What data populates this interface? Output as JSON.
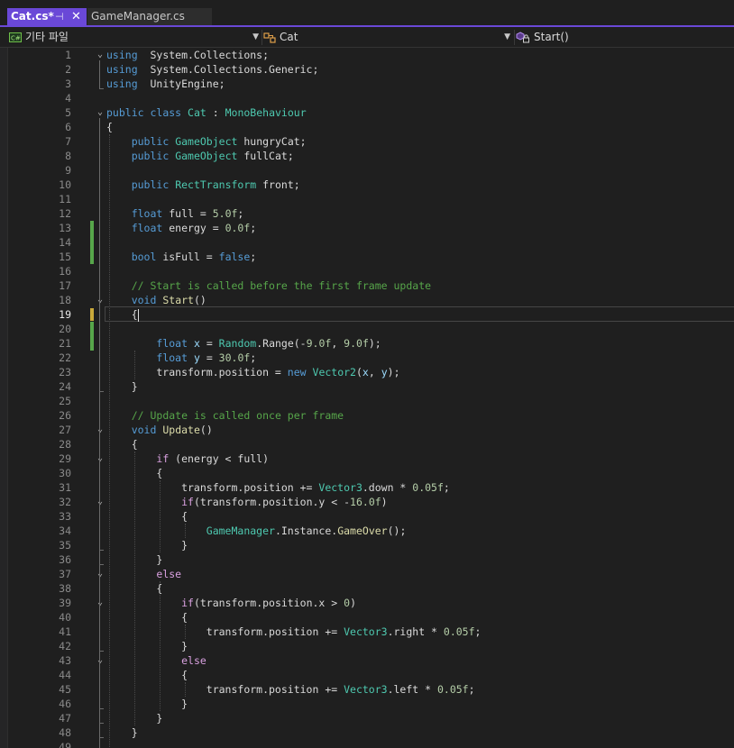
{
  "tabs": [
    {
      "label": "Cat.cs*",
      "active": true
    },
    {
      "label": "GameManager.cs",
      "active": false
    }
  ],
  "icons": {
    "tab_pin": "pin-icon",
    "tab_close": "close-icon",
    "project": "csharp-project-icon",
    "class": "class-icon",
    "member": "method-lock-icon",
    "dropdown": "chevron-down-icon"
  },
  "navbar": {
    "project": "기타 파일",
    "class": "Cat",
    "member": "Start()"
  },
  "colors": {
    "accent": "#6a48d7",
    "keyword": "#569cd6",
    "type": "#4ec9b0",
    "comment": "#57a64a",
    "number": "#b5cea8",
    "variable": "#9cdcfe",
    "control": "#d8a0df",
    "method": "#dcdcaa",
    "saved_change": "#57a64a",
    "unsaved_change": "#c9a93a"
  },
  "editor": {
    "current_line": 19,
    "lines": [
      [
        [
          "kw",
          "using"
        ],
        [
          "",
          "  System.Collections;"
        ]
      ],
      [
        [
          "kw",
          "using"
        ],
        [
          "",
          "  System.Collections.Generic;"
        ]
      ],
      [
        [
          "kw",
          "using"
        ],
        [
          "",
          "  UnityEngine;"
        ]
      ],
      [],
      [
        [
          "kw",
          "public"
        ],
        [
          "",
          " "
        ],
        [
          "kw",
          "class"
        ],
        [
          "",
          " "
        ],
        [
          "ty",
          "Cat"
        ],
        [
          "",
          " : "
        ],
        [
          "ty",
          "MonoBehaviour"
        ]
      ],
      [
        [
          "",
          "{"
        ]
      ],
      [
        [
          "",
          "    "
        ],
        [
          "kw",
          "public"
        ],
        [
          "",
          " "
        ],
        [
          "ty",
          "GameObject"
        ],
        [
          "",
          " hungryCat;"
        ]
      ],
      [
        [
          "",
          "    "
        ],
        [
          "kw",
          "public"
        ],
        [
          "",
          " "
        ],
        [
          "ty",
          "GameObject"
        ],
        [
          "",
          " fullCat;"
        ]
      ],
      [],
      [
        [
          "",
          "    "
        ],
        [
          "kw",
          "public"
        ],
        [
          "",
          " "
        ],
        [
          "ty",
          "RectTransform"
        ],
        [
          "",
          " front;"
        ]
      ],
      [],
      [
        [
          "",
          "    "
        ],
        [
          "kw",
          "float"
        ],
        [
          "",
          " full = "
        ],
        [
          "nm",
          "5.0f"
        ],
        [
          "",
          ";"
        ]
      ],
      [
        [
          "",
          "    "
        ],
        [
          "kw",
          "float"
        ],
        [
          "",
          " energy = "
        ],
        [
          "nm",
          "0.0f"
        ],
        [
          "",
          ";"
        ]
      ],
      [],
      [
        [
          "",
          "    "
        ],
        [
          "kw",
          "bool"
        ],
        [
          "",
          " isFull = "
        ],
        [
          "kw",
          "false"
        ],
        [
          "",
          ";"
        ]
      ],
      [],
      [
        [
          "",
          "    "
        ],
        [
          "cm",
          "// Start is called before the first frame update"
        ]
      ],
      [
        [
          "",
          "    "
        ],
        [
          "kw",
          "void"
        ],
        [
          "",
          " "
        ],
        [
          "fn",
          "Start"
        ],
        [
          "",
          "()"
        ]
      ],
      [
        [
          "",
          "    {"
        ],
        [
          "cursor",
          ""
        ]
      ],
      [],
      [
        [
          "",
          "        "
        ],
        [
          "kw",
          "float"
        ],
        [
          "",
          " "
        ],
        [
          "vr",
          "x"
        ],
        [
          "",
          " = "
        ],
        [
          "ty",
          "Random"
        ],
        [
          "",
          ".Range(-"
        ],
        [
          "nm",
          "9.0f"
        ],
        [
          "",
          ", "
        ],
        [
          "nm",
          "9.0f"
        ],
        [
          "",
          ");"
        ]
      ],
      [
        [
          "",
          "        "
        ],
        [
          "kw",
          "float"
        ],
        [
          "",
          " "
        ],
        [
          "vr",
          "y"
        ],
        [
          "",
          " = "
        ],
        [
          "nm",
          "30.0f"
        ],
        [
          "",
          ";"
        ]
      ],
      [
        [
          "",
          "        transform.position = "
        ],
        [
          "kw",
          "new"
        ],
        [
          "",
          " "
        ],
        [
          "ty",
          "Vector2"
        ],
        [
          "",
          "("
        ],
        [
          "vr",
          "x"
        ],
        [
          "",
          ", "
        ],
        [
          "vr",
          "y"
        ],
        [
          "",
          ");"
        ]
      ],
      [
        [
          "",
          "    }"
        ]
      ],
      [],
      [
        [
          "",
          "    "
        ],
        [
          "cm",
          "// Update is called once per frame"
        ]
      ],
      [
        [
          "",
          "    "
        ],
        [
          "kw",
          "void"
        ],
        [
          "",
          " "
        ],
        [
          "fn",
          "Update"
        ],
        [
          "",
          "()"
        ]
      ],
      [
        [
          "",
          "    {"
        ]
      ],
      [
        [
          "",
          "        "
        ],
        [
          "kc",
          "if"
        ],
        [
          "",
          " (energy < full)"
        ]
      ],
      [
        [
          "",
          "        {"
        ]
      ],
      [
        [
          "",
          "            transform.position += "
        ],
        [
          "ty",
          "Vector3"
        ],
        [
          "",
          ".down * "
        ],
        [
          "nm",
          "0.05f"
        ],
        [
          "",
          ";"
        ]
      ],
      [
        [
          "",
          "            "
        ],
        [
          "kc",
          "if"
        ],
        [
          "",
          "(transform.position.y < -"
        ],
        [
          "nm",
          "16.0f"
        ],
        [
          "",
          ")"
        ]
      ],
      [
        [
          "",
          "            {"
        ]
      ],
      [
        [
          "",
          "                "
        ],
        [
          "ty",
          "GameManager"
        ],
        [
          "",
          ".Instance."
        ],
        [
          "fn",
          "GameOver"
        ],
        [
          "",
          "();"
        ]
      ],
      [
        [
          "",
          "            }"
        ]
      ],
      [
        [
          "",
          "        }"
        ]
      ],
      [
        [
          "",
          "        "
        ],
        [
          "kc",
          "else"
        ]
      ],
      [
        [
          "",
          "        {"
        ]
      ],
      [
        [
          "",
          "            "
        ],
        [
          "kc",
          "if"
        ],
        [
          "",
          "(transform.position.x > "
        ],
        [
          "nm",
          "0"
        ],
        [
          "",
          ")"
        ]
      ],
      [
        [
          "",
          "            {"
        ]
      ],
      [
        [
          "",
          "                transform.position += "
        ],
        [
          "ty",
          "Vector3"
        ],
        [
          "",
          ".right * "
        ],
        [
          "nm",
          "0.05f"
        ],
        [
          "",
          ";"
        ]
      ],
      [
        [
          "",
          "            }"
        ]
      ],
      [
        [
          "",
          "            "
        ],
        [
          "kc",
          "else"
        ]
      ],
      [
        [
          "",
          "            {"
        ]
      ],
      [
        [
          "",
          "                transform.position += "
        ],
        [
          "ty",
          "Vector3"
        ],
        [
          "",
          ".left * "
        ],
        [
          "nm",
          "0.05f"
        ],
        [
          "",
          ";"
        ]
      ],
      [
        [
          "",
          "            }"
        ]
      ],
      [
        [
          "",
          "        }"
        ]
      ],
      [
        [
          "",
          "    }"
        ]
      ],
      []
    ]
  }
}
